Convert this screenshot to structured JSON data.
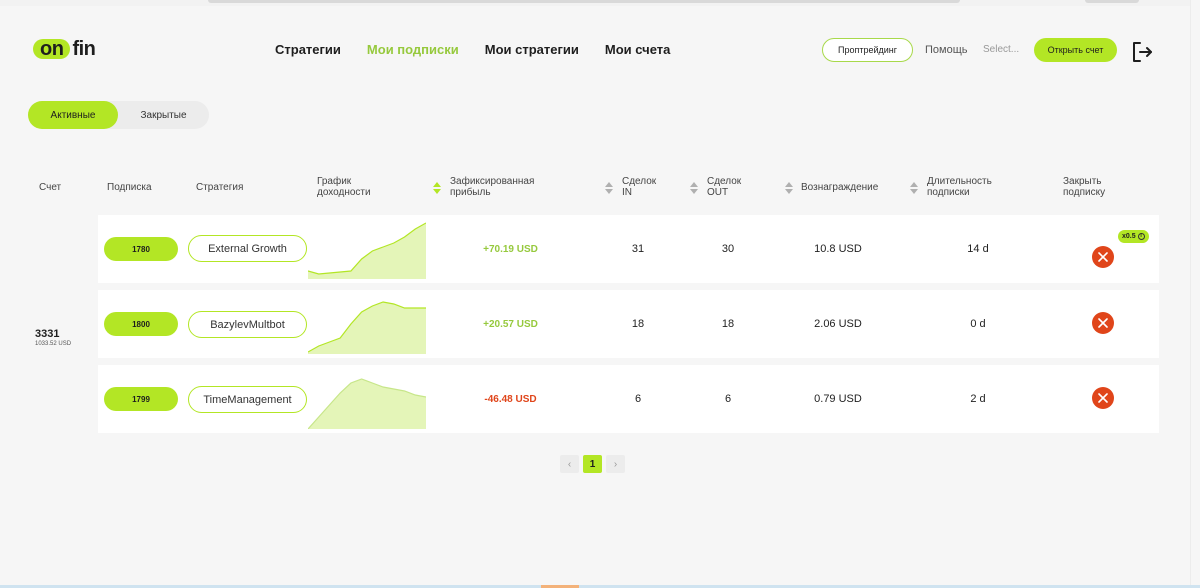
{
  "header": {
    "logo_pill": "on",
    "logo_rest": "fin",
    "nav": [
      {
        "label": "Стратегии",
        "active": false
      },
      {
        "label": "Мои подписки",
        "active": true
      },
      {
        "label": "Мои стратегии",
        "active": false
      },
      {
        "label": "Мои счета",
        "active": false
      }
    ],
    "proptrading_label": "Проптрейдинг",
    "help_label": "Помощь",
    "select_placeholder": "Select...",
    "open_account_label": "Открыть счет",
    "logout_icon": "logout-icon"
  },
  "tabs": [
    {
      "label": "Активные",
      "active": true
    },
    {
      "label": "Закрытые",
      "active": false
    }
  ],
  "table": {
    "headers": {
      "account": "Счет",
      "subscription": "Подписка",
      "strategy": "Стратегия",
      "chart_line1": "График",
      "chart_line2": "доходности",
      "profit_line1": "Зафиксированная",
      "profit_line2": "прибыль",
      "deals_in_line1": "Сделок",
      "deals_in_line2": "IN",
      "deals_out_line1": "Сделок",
      "deals_out_line2": "OUT",
      "reward": "Вознаграждение",
      "duration_line1": "Длительность",
      "duration_line2": "подписки",
      "close_line1": "Закрыть",
      "close_line2": "подписку"
    },
    "account": {
      "number": "3331",
      "balance": "1033.52 USD"
    },
    "rows": [
      {
        "subscription": "1780",
        "strategy": "External Growth",
        "profit": "+70.19 USD",
        "profit_sign": "pos",
        "deals_in": "31",
        "deals_out": "30",
        "reward": "10.8 USD",
        "duration": "14 d",
        "badge": "x0.5",
        "sparkline": [
          52,
          55,
          54,
          53,
          52,
          40,
          32,
          28,
          24,
          18,
          10,
          4
        ]
      },
      {
        "subscription": "1800",
        "strategy": "BazylevMultbot",
        "profit": "+20.57 USD",
        "profit_sign": "pos",
        "deals_in": "18",
        "deals_out": "18",
        "reward": "2.06 USD",
        "duration": "0 d",
        "badge": "",
        "sparkline": [
          58,
          52,
          48,
          44,
          30,
          18,
          12,
          8,
          10,
          14,
          14,
          14
        ]
      },
      {
        "subscription": "1799",
        "strategy": "TimeManagement",
        "profit": "-46.48 USD",
        "profit_sign": "neg",
        "deals_in": "6",
        "deals_out": "6",
        "reward": "0.79 USD",
        "duration": "2 d",
        "badge": "",
        "sparkline": [
          60,
          48,
          36,
          24,
          14,
          10,
          14,
          18,
          20,
          22,
          26,
          28
        ]
      }
    ]
  },
  "pagination": {
    "current": "1",
    "prev_icon": "chevron-left-icon",
    "next_icon": "chevron-right-icon"
  },
  "colors": {
    "accent": "#b3e625",
    "accent_text": "#96c93d",
    "negative": "#e0451a",
    "background": "#f6f6f6"
  }
}
